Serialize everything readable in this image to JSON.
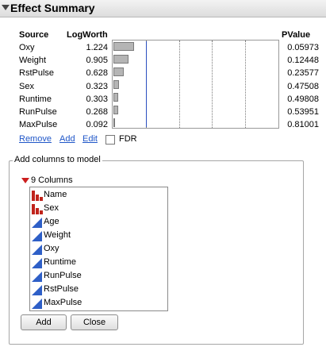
{
  "header": {
    "title": "Effect Summary"
  },
  "table": {
    "columns": {
      "source": "Source",
      "logworth": "LogWorth",
      "pvalue": "PValue"
    },
    "rows": [
      {
        "source": "Oxy",
        "logworth": "1.224",
        "pvalue": "0.05973",
        "lw": 1.224
      },
      {
        "source": "Weight",
        "logworth": "0.905",
        "pvalue": "0.12448",
        "lw": 0.905
      },
      {
        "source": "RstPulse",
        "logworth": "0.628",
        "pvalue": "0.23577",
        "lw": 0.628
      },
      {
        "source": "Sex",
        "logworth": "0.323",
        "pvalue": "0.47508",
        "lw": 0.323
      },
      {
        "source": "Runtime",
        "logworth": "0.303",
        "pvalue": "0.49808",
        "lw": 0.303
      },
      {
        "source": "RunPulse",
        "logworth": "0.268",
        "pvalue": "0.53951",
        "lw": 0.268
      },
      {
        "source": "MaxPulse",
        "logworth": "0.092",
        "pvalue": "0.81001",
        "lw": 0.092
      }
    ],
    "bar_axis_max": 10,
    "gridlines": [
      2,
      4,
      6,
      8
    ],
    "reference_line": 2
  },
  "actions": {
    "remove": "Remove",
    "add": "Add",
    "edit": "Edit",
    "fdr": "FDR",
    "fdr_checked": false
  },
  "add_columns": {
    "title": "Add columns to model",
    "count_label": "9 Columns",
    "columns": [
      {
        "name": "Name",
        "type": "nominal"
      },
      {
        "name": "Sex",
        "type": "nominal"
      },
      {
        "name": "Age",
        "type": "continuous"
      },
      {
        "name": "Weight",
        "type": "continuous"
      },
      {
        "name": "Oxy",
        "type": "continuous"
      },
      {
        "name": "Runtime",
        "type": "continuous"
      },
      {
        "name": "RunPulse",
        "type": "continuous"
      },
      {
        "name": "RstPulse",
        "type": "continuous"
      },
      {
        "name": "MaxPulse",
        "type": "continuous"
      }
    ],
    "add_button": "Add",
    "close_button": "Close"
  },
  "colors": {
    "link": "#1f56c8",
    "nominal_icon": "#c0241c",
    "continuous_icon": "#2e5fc7",
    "reference_line": "#2b4fbf"
  }
}
